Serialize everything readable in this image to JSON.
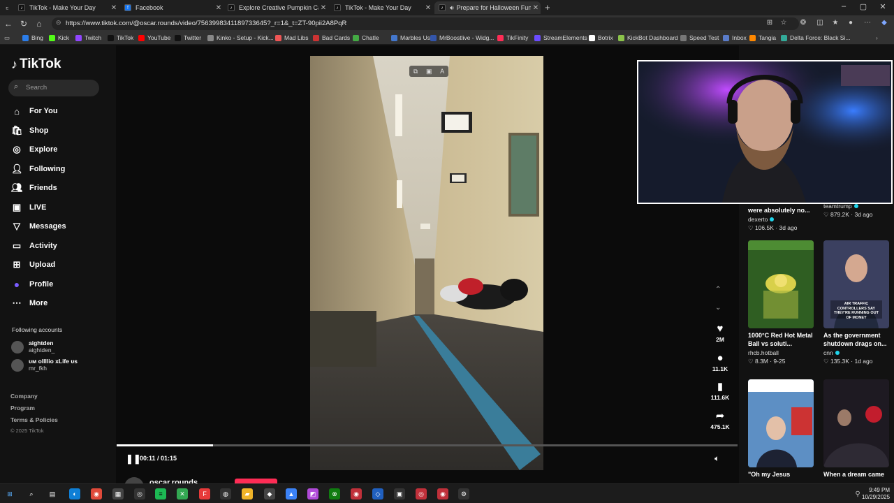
{
  "browser": {
    "tabs": [
      {
        "title": "TikTok - Make Your Day",
        "icon": "tiktok-icon",
        "active": false
      },
      {
        "title": "Facebook",
        "icon": "facebook-icon",
        "active": false
      },
      {
        "title": "Explore Creative Pumpkin Carving",
        "icon": "tiktok-icon",
        "active": false
      },
      {
        "title": "TikTok - Make Your Day",
        "icon": "tiktok-icon",
        "active": false
      },
      {
        "title": "Prepare for Halloween Fun w",
        "icon": "tiktok-icon",
        "active": true
      }
    ],
    "url": "https://www.tiktok.com/@oscar.rounds/video/7563998341189733645?_r=1&_t=ZT-90pii2A8PqR",
    "bookmarks": [
      "Bing",
      "Kick",
      "Twitch",
      "TikTok",
      "YouTube",
      "Twitter",
      "Kinko - Setup - Kick...",
      "Mad Libs",
      "Bad Cards",
      "Chatle",
      "Marbles User",
      "MrBoostlive - Widg...",
      "TikFinity",
      "StreamElements",
      "Botrix",
      "KickBot Dashboard",
      "Speed Test",
      "Inbox",
      "Tangia",
      "Delta Force: Black Si..."
    ]
  },
  "sidebar": {
    "logo": "TikTok",
    "search_placeholder": "Search",
    "nav": [
      {
        "label": "For You",
        "icon": "home-icon"
      },
      {
        "label": "Shop",
        "icon": "shop-icon"
      },
      {
        "label": "Explore",
        "icon": "compass-icon"
      },
      {
        "label": "Following",
        "icon": "following-icon"
      },
      {
        "label": "Friends",
        "icon": "friends-icon"
      },
      {
        "label": "LIVE",
        "icon": "live-icon"
      },
      {
        "label": "Messages",
        "icon": "messages-icon"
      },
      {
        "label": "Activity",
        "icon": "activity-icon"
      },
      {
        "label": "Upload",
        "icon": "upload-icon"
      },
      {
        "label": "Profile",
        "icon": "profile-icon"
      },
      {
        "label": "More",
        "icon": "more-icon"
      }
    ],
    "following_title": "Following accounts",
    "accounts": [
      {
        "name": "aightden",
        "handle": "aightden_"
      },
      {
        "name": "ᴜᴍ ollllio xLife ᴜs",
        "handle": "mr_fkh"
      }
    ],
    "footer": [
      "Company",
      "Program",
      "Terms & Policies"
    ],
    "copyright": "© 2025 TikTok"
  },
  "player": {
    "time": "00:11 / 01:15",
    "progress": 0.155,
    "author": "oscar.rounds",
    "actions": [
      {
        "icon": "heart-icon",
        "count": "2M"
      },
      {
        "icon": "comment-icon",
        "count": "11.1K"
      },
      {
        "icon": "bookmark-icon",
        "count": "111.6K"
      },
      {
        "icon": "share-icon",
        "count": "475.1K"
      }
    ]
  },
  "feed": {
    "top": [
      {
        "title": "were absolutely no...",
        "user": "dexerto",
        "verified": true,
        "meta": "♡ 106.5K · 3d ago"
      },
      {
        "title": "",
        "user": "teamtrump",
        "verified": true,
        "meta": "♡ 879.2K · 3d ago"
      }
    ],
    "cards": [
      {
        "title": "1000°C Red Hot Metal Ball vs soluti...",
        "user": "rhcb.hotball",
        "verified": false,
        "meta": "♡ 8.3M · 9-25",
        "thumb_bg": "#3a6b2a"
      },
      {
        "title": "As the government shutdown drags on...",
        "user": "cnn",
        "verified": true,
        "meta": "♡ 135.3K · 1d ago",
        "thumb_bg": "#2b3450",
        "overlay": "AIR TRAFFIC CONTROLLERS SAY THEY'RE RUNNING OUT OF MONEY"
      },
      {
        "title": "\"Oh my Jesus",
        "user": "",
        "verified": false,
        "meta": "",
        "thumb_bg": "#3d6fa8"
      },
      {
        "title": "When a dream came",
        "user": "",
        "verified": false,
        "meta": "",
        "thumb_bg": "#2a1f25"
      }
    ]
  },
  "taskbar": {
    "time": "9:49 PM",
    "date": "10/29/2025"
  },
  "colors": {
    "tiktok_red": "#fe2c55",
    "tiktok_cyan": "#20d5ec"
  }
}
